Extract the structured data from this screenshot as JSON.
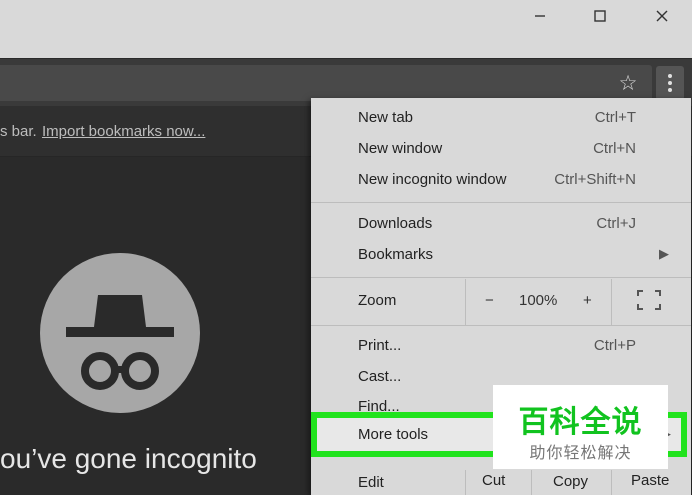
{
  "window": {
    "minimize_icon": "minimize-icon",
    "maximize_icon": "maximize-icon",
    "close_icon": "close-icon"
  },
  "toolbar": {
    "star_glyph": "☆",
    "menu_icon": "kebab-menu-icon"
  },
  "bookmarks_bar": {
    "text": "s bar.",
    "link": "Import bookmarks now..."
  },
  "incognito": {
    "title": "ou’ve gone incognito"
  },
  "menu": {
    "new_tab": {
      "label": "New tab",
      "shortcut": "Ctrl+T"
    },
    "new_window": {
      "label": "New window",
      "shortcut": "Ctrl+N"
    },
    "new_incognito": {
      "label": "New incognito window",
      "shortcut": "Ctrl+Shift+N"
    },
    "downloads": {
      "label": "Downloads",
      "shortcut": "Ctrl+J"
    },
    "bookmarks": {
      "label": "Bookmarks"
    },
    "zoom": {
      "label": "Zoom",
      "minus": "−",
      "value": "100%",
      "plus": "+"
    },
    "print": {
      "label": "Print...",
      "shortcut": "Ctrl+P"
    },
    "cast": {
      "label": "Cast..."
    },
    "find": {
      "label": "Find..."
    },
    "more_tools": {
      "label": "More tools"
    },
    "edit": {
      "label": "Edit",
      "cut": "Cut",
      "copy": "Copy",
      "paste": "Paste"
    }
  },
  "watermark": {
    "title": "百科全说",
    "subtitle": "助你轻松解决"
  },
  "colors": {
    "highlight": "#21e31d",
    "watermark_green": "#11c31f"
  }
}
